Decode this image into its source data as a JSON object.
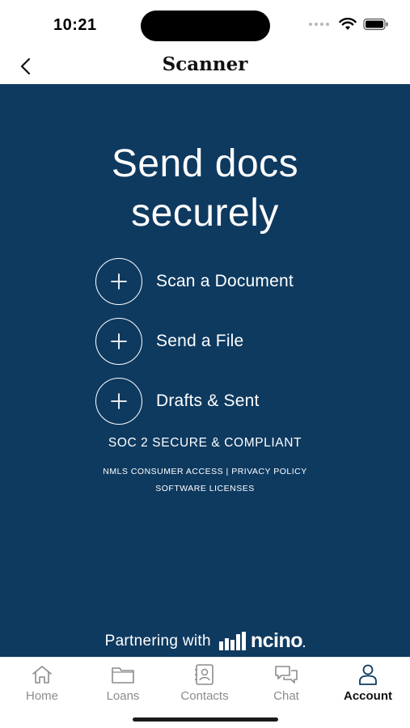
{
  "status_bar": {
    "time": "10:21",
    "icons": [
      "signal-dots-icon",
      "wifi-icon",
      "battery-icon"
    ]
  },
  "header": {
    "title": "Scanner",
    "back_icon": "chevron-left-icon"
  },
  "main": {
    "background_color": "#0e3a60",
    "hero_line1": "Send docs",
    "hero_line2": "securely",
    "actions": [
      {
        "label": "Scan a Document",
        "icon": "plus-icon"
      },
      {
        "label": "Send a File",
        "icon": "plus-icon"
      },
      {
        "label": "Drafts & Sent",
        "icon": "plus-icon"
      }
    ],
    "soc_text": "SOC 2 SECURE & COMPLIANT",
    "links": {
      "nmls": "NMLS CONSUMER ACCESS",
      "separator": "|",
      "privacy": "PRIVACY POLICY",
      "licenses": "SOFTWARE LICENSES"
    },
    "partner": {
      "text": "Partnering with",
      "logo_text": "ncino",
      "logo_suffix": "."
    }
  },
  "tab_bar": {
    "tabs": [
      {
        "label": "Home",
        "icon": "home-icon",
        "active": false
      },
      {
        "label": "Loans",
        "icon": "folder-icon",
        "active": false
      },
      {
        "label": "Contacts",
        "icon": "contacts-icon",
        "active": false
      },
      {
        "label": "Chat",
        "icon": "chat-icon",
        "active": false
      },
      {
        "label": "Account",
        "icon": "person-icon",
        "active": true
      }
    ]
  }
}
